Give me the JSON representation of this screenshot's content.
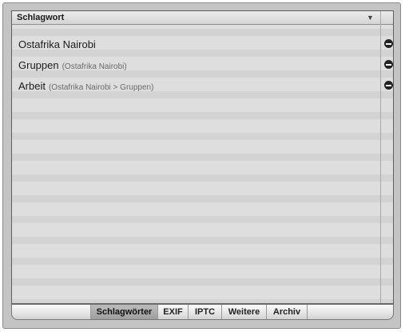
{
  "table": {
    "column_header": "Schlagwort",
    "sort_indicator": "▼",
    "rows": [
      {
        "name": "Ostafrika Nairobi",
        "path": ""
      },
      {
        "name": "Gruppen",
        "path": "(Ostafrika Nairobi)"
      },
      {
        "name": "Arbeit",
        "path": "(Ostafrika Nairobi > Gruppen)"
      }
    ],
    "remove_icon": "minus-circle-icon"
  },
  "tabs": [
    {
      "label": "Schlagwörter",
      "active": true
    },
    {
      "label": "EXIF",
      "active": false
    },
    {
      "label": "IPTC",
      "active": false
    },
    {
      "label": "Weitere",
      "active": false
    },
    {
      "label": "Archiv",
      "active": false
    }
  ],
  "colors": {
    "stripe_light": "#dedede",
    "stripe_dark": "#d3d3d3",
    "active_tab": "#a8a8a8"
  }
}
